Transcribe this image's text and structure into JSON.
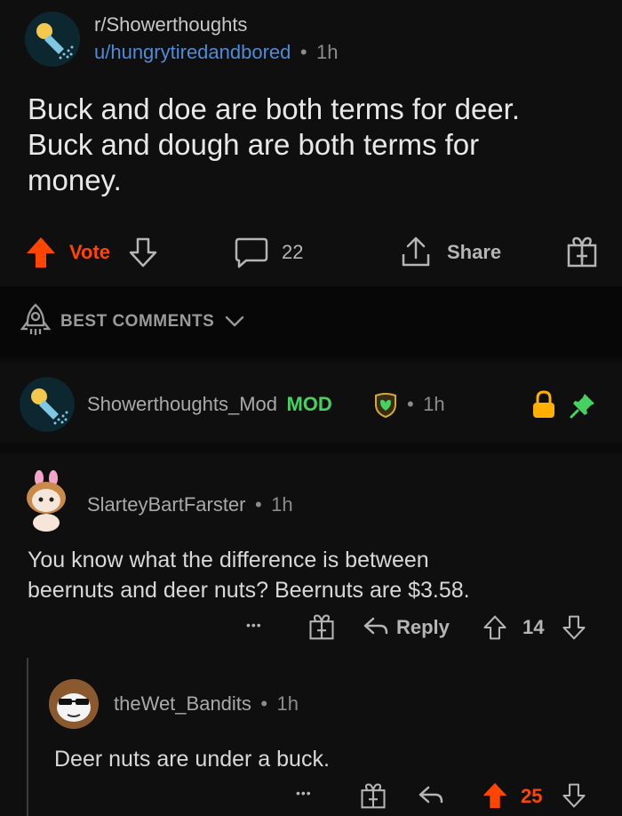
{
  "post": {
    "subreddit": "r/Showerthoughts",
    "author": "u/hungrytiredandbored",
    "separator": "•",
    "time": "1h",
    "title_lines": [
      "Buck and doe are both terms for deer.",
      "Buck and dough are both terms for",
      "money."
    ],
    "vote_label": "Vote",
    "comment_count": "22",
    "share_label": "Share"
  },
  "sort": {
    "label": "BEST COMMENTS"
  },
  "mod_comment": {
    "username": "Showerthoughts_Mod",
    "badge": "MOD",
    "separator": "•",
    "time": "1h"
  },
  "comments": [
    {
      "username": "SlarteyBartFarster",
      "separator": "•",
      "time": "1h",
      "lines": [
        "You know what the difference is between",
        "beernuts and deer nuts? Beernuts are $3.58."
      ],
      "more": "•••",
      "reply_label": "Reply",
      "score": "14"
    },
    {
      "username": "theWet_Bandits",
      "separator": "•",
      "time": "1h",
      "lines": [
        "Deer nuts are under a buck."
      ],
      "more": "•••",
      "score": "25"
    }
  ],
  "colors": {
    "upvote": "#ff4500",
    "mod_green": "#46d160",
    "link_blue": "#4f8bd6",
    "lock_yellow": "#ffb000",
    "background": "#0b0b0b"
  },
  "icons": [
    "upvote-arrow-icon",
    "downvote-arrow-icon",
    "comment-bubble-icon",
    "share-icon",
    "award-gift-icon",
    "rocket-icon",
    "chevron-down-icon",
    "lock-icon",
    "pin-icon",
    "mod-shield-icon",
    "reply-arrow-icon"
  ]
}
